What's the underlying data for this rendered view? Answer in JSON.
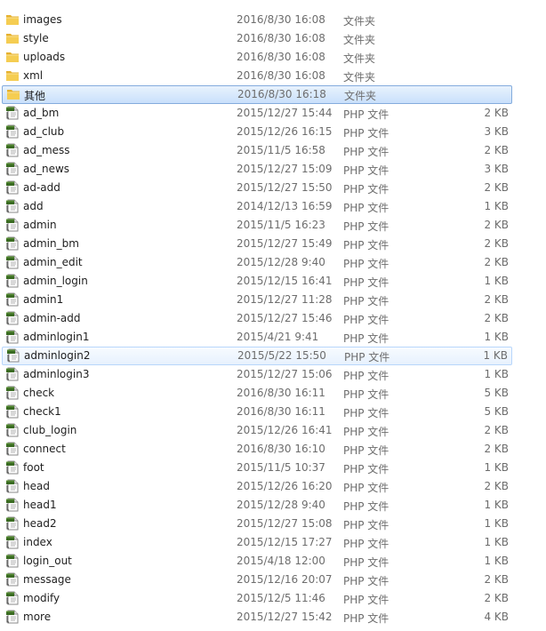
{
  "icons": {
    "folder": "folder-icon",
    "php": "php-file-icon"
  },
  "colors": {
    "selection_bg": "#c9e0fb",
    "selection_border": "#84acdd",
    "hover_border": "#b8d6fb",
    "folder": "#f0c23c",
    "php_badge": "#3a6b22"
  },
  "files": [
    {
      "name": "images",
      "date": "2016/8/30 16:08",
      "type": "文件夹",
      "size": "",
      "kind": "folder"
    },
    {
      "name": "style",
      "date": "2016/8/30 16:08",
      "type": "文件夹",
      "size": "",
      "kind": "folder"
    },
    {
      "name": "uploads",
      "date": "2016/8/30 16:08",
      "type": "文件夹",
      "size": "",
      "kind": "folder"
    },
    {
      "name": "xml",
      "date": "2016/8/30 16:08",
      "type": "文件夹",
      "size": "",
      "kind": "folder"
    },
    {
      "name": "其他",
      "date": "2016/8/30 16:18",
      "type": "文件夹",
      "size": "",
      "kind": "folder",
      "state": "selected"
    },
    {
      "name": "ad_bm",
      "date": "2015/12/27 15:44",
      "type": "PHP 文件",
      "size": "2 KB",
      "kind": "php"
    },
    {
      "name": "ad_club",
      "date": "2015/12/26 16:15",
      "type": "PHP 文件",
      "size": "3 KB",
      "kind": "php"
    },
    {
      "name": "ad_mess",
      "date": "2015/11/5 16:58",
      "type": "PHP 文件",
      "size": "2 KB",
      "kind": "php"
    },
    {
      "name": "ad_news",
      "date": "2015/12/27 15:09",
      "type": "PHP 文件",
      "size": "3 KB",
      "kind": "php"
    },
    {
      "name": "ad-add",
      "date": "2015/12/27 15:50",
      "type": "PHP 文件",
      "size": "2 KB",
      "kind": "php"
    },
    {
      "name": "add",
      "date": "2014/12/13 16:59",
      "type": "PHP 文件",
      "size": "1 KB",
      "kind": "php"
    },
    {
      "name": "admin",
      "date": "2015/11/5 16:23",
      "type": "PHP 文件",
      "size": "2 KB",
      "kind": "php"
    },
    {
      "name": "admin_bm",
      "date": "2015/12/27 15:49",
      "type": "PHP 文件",
      "size": "2 KB",
      "kind": "php"
    },
    {
      "name": "admin_edit",
      "date": "2015/12/28 9:40",
      "type": "PHP 文件",
      "size": "2 KB",
      "kind": "php"
    },
    {
      "name": "admin_login",
      "date": "2015/12/15 16:41",
      "type": "PHP 文件",
      "size": "1 KB",
      "kind": "php"
    },
    {
      "name": "admin1",
      "date": "2015/12/27 11:28",
      "type": "PHP 文件",
      "size": "2 KB",
      "kind": "php"
    },
    {
      "name": "admin-add",
      "date": "2015/12/27 15:46",
      "type": "PHP 文件",
      "size": "2 KB",
      "kind": "php"
    },
    {
      "name": "adminlogin1",
      "date": "2015/4/21 9:41",
      "type": "PHP 文件",
      "size": "1 KB",
      "kind": "php"
    },
    {
      "name": "adminlogin2",
      "date": "2015/5/22 15:50",
      "type": "PHP 文件",
      "size": "1 KB",
      "kind": "php",
      "state": "hovered"
    },
    {
      "name": "adminlogin3",
      "date": "2015/12/27 15:06",
      "type": "PHP 文件",
      "size": "1 KB",
      "kind": "php"
    },
    {
      "name": "check",
      "date": "2016/8/30 16:11",
      "type": "PHP 文件",
      "size": "5 KB",
      "kind": "php"
    },
    {
      "name": "check1",
      "date": "2016/8/30 16:11",
      "type": "PHP 文件",
      "size": "5 KB",
      "kind": "php"
    },
    {
      "name": "club_login",
      "date": "2015/12/26 16:41",
      "type": "PHP 文件",
      "size": "2 KB",
      "kind": "php"
    },
    {
      "name": "connect",
      "date": "2016/8/30 16:10",
      "type": "PHP 文件",
      "size": "2 KB",
      "kind": "php"
    },
    {
      "name": "foot",
      "date": "2015/11/5 10:37",
      "type": "PHP 文件",
      "size": "1 KB",
      "kind": "php"
    },
    {
      "name": "head",
      "date": "2015/12/26 16:20",
      "type": "PHP 文件",
      "size": "2 KB",
      "kind": "php"
    },
    {
      "name": "head1",
      "date": "2015/12/28 9:40",
      "type": "PHP 文件",
      "size": "1 KB",
      "kind": "php"
    },
    {
      "name": "head2",
      "date": "2015/12/27 15:08",
      "type": "PHP 文件",
      "size": "1 KB",
      "kind": "php"
    },
    {
      "name": "index",
      "date": "2015/12/15 17:27",
      "type": "PHP 文件",
      "size": "1 KB",
      "kind": "php"
    },
    {
      "name": "login_out",
      "date": "2015/4/18 12:00",
      "type": "PHP 文件",
      "size": "1 KB",
      "kind": "php"
    },
    {
      "name": "message",
      "date": "2015/12/16 20:07",
      "type": "PHP 文件",
      "size": "2 KB",
      "kind": "php"
    },
    {
      "name": "modify",
      "date": "2015/12/5 11:46",
      "type": "PHP 文件",
      "size": "2 KB",
      "kind": "php"
    },
    {
      "name": "more",
      "date": "2015/12/27 15:42",
      "type": "PHP 文件",
      "size": "4 KB",
      "kind": "php"
    }
  ]
}
